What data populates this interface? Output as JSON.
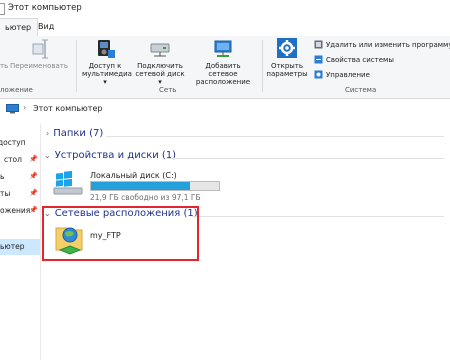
{
  "window": {
    "title": "Этот компьютер"
  },
  "tabs": [
    {
      "label": "ьютер"
    },
    {
      "label": "Вид"
    }
  ],
  "ribbon": {
    "buttons": {
      "rename_prefix": "ть",
      "rename": "Переименовать",
      "access_media": [
        "Доступ к",
        "мультимедиа ▾"
      ],
      "map_drive": [
        "Подключить",
        "сетевой диск ▾"
      ],
      "add_location": [
        "Добавить сетевое",
        "расположение"
      ],
      "open_settings": [
        "Открыть",
        "параметры"
      ]
    },
    "small_items": {
      "uninstall": "Удалить или изменить программу",
      "system_properties": "Свойства системы",
      "manage": "Управление"
    },
    "groups": {
      "location": "ложение",
      "network": "Сеть",
      "system": "Система"
    }
  },
  "address": {
    "path": "Этот компьютер",
    "arrow": "›"
  },
  "nav": {
    "items": [
      "доступ",
      "стол",
      "ь",
      "ты",
      "ожения",
      "ьютер"
    ],
    "pin": "📌"
  },
  "groups": {
    "folders": {
      "title": "Папки (7)",
      "chevron": "›"
    },
    "devices": {
      "title": "Устройства и диски (1)",
      "chevron": "⌄"
    },
    "network": {
      "title": "Сетевые расположения (1)",
      "chevron": "⌄"
    }
  },
  "drive": {
    "name": "Локальный диск (C:)",
    "free_text": "21,9 ГБ свободно из 97,1 ГБ",
    "used_fraction": 0.775
  },
  "network_location": {
    "name": "my_FTP"
  },
  "colors": {
    "accent": "#26a0da",
    "group_header": "#1e3287",
    "highlight_box": "#e3262e",
    "selection": "#cce8ff"
  },
  "icons": [
    "access-media-icon",
    "map-drive-icon",
    "add-location-icon",
    "settings-gear-icon",
    "uninstall-icon",
    "system-properties-icon",
    "manage-icon",
    "computer-icon",
    "windows-drive-icon",
    "ftp-location-icon",
    "pin-icon",
    "rename-icon"
  ]
}
